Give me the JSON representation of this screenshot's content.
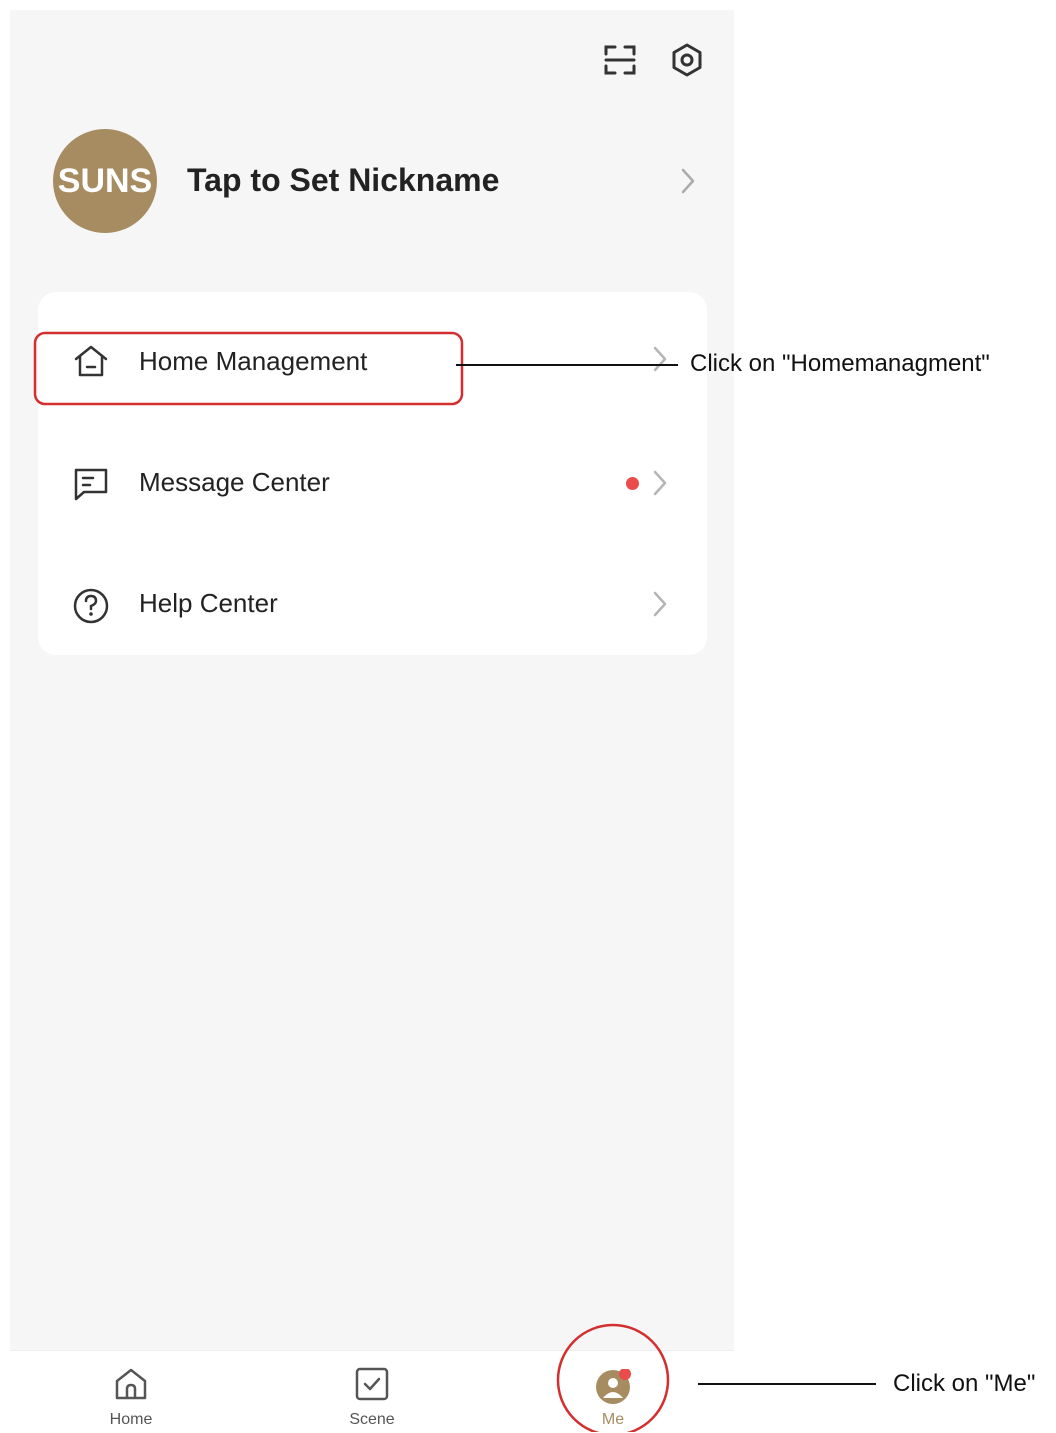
{
  "header": {
    "icons": [
      "scan-icon",
      "settings-icon"
    ]
  },
  "profile": {
    "avatar_text": "SUNS",
    "nickname": "Tap to Set Nickname"
  },
  "menu": {
    "items": [
      {
        "label": "Home Management",
        "icon": "house-icon",
        "badge": false
      },
      {
        "label": "Message Center",
        "icon": "message-icon",
        "badge": true
      },
      {
        "label": "Help Center",
        "icon": "question-circle-icon",
        "badge": false
      }
    ]
  },
  "tabbar": {
    "tabs": [
      {
        "label": "Home",
        "icon": "home-tab-icon"
      },
      {
        "label": "Scene",
        "icon": "scene-tab-icon"
      },
      {
        "label": "Me",
        "icon": "me-tab-icon",
        "active": true
      }
    ]
  },
  "annotations": {
    "home_management": "Click on \"Homemanagment\"",
    "me": "Click on \"Me\""
  },
  "colors": {
    "accent": "#a68c60",
    "badge": "#ea4b4b",
    "annotation": "#d32f2f",
    "background": "#f6f6f6"
  }
}
